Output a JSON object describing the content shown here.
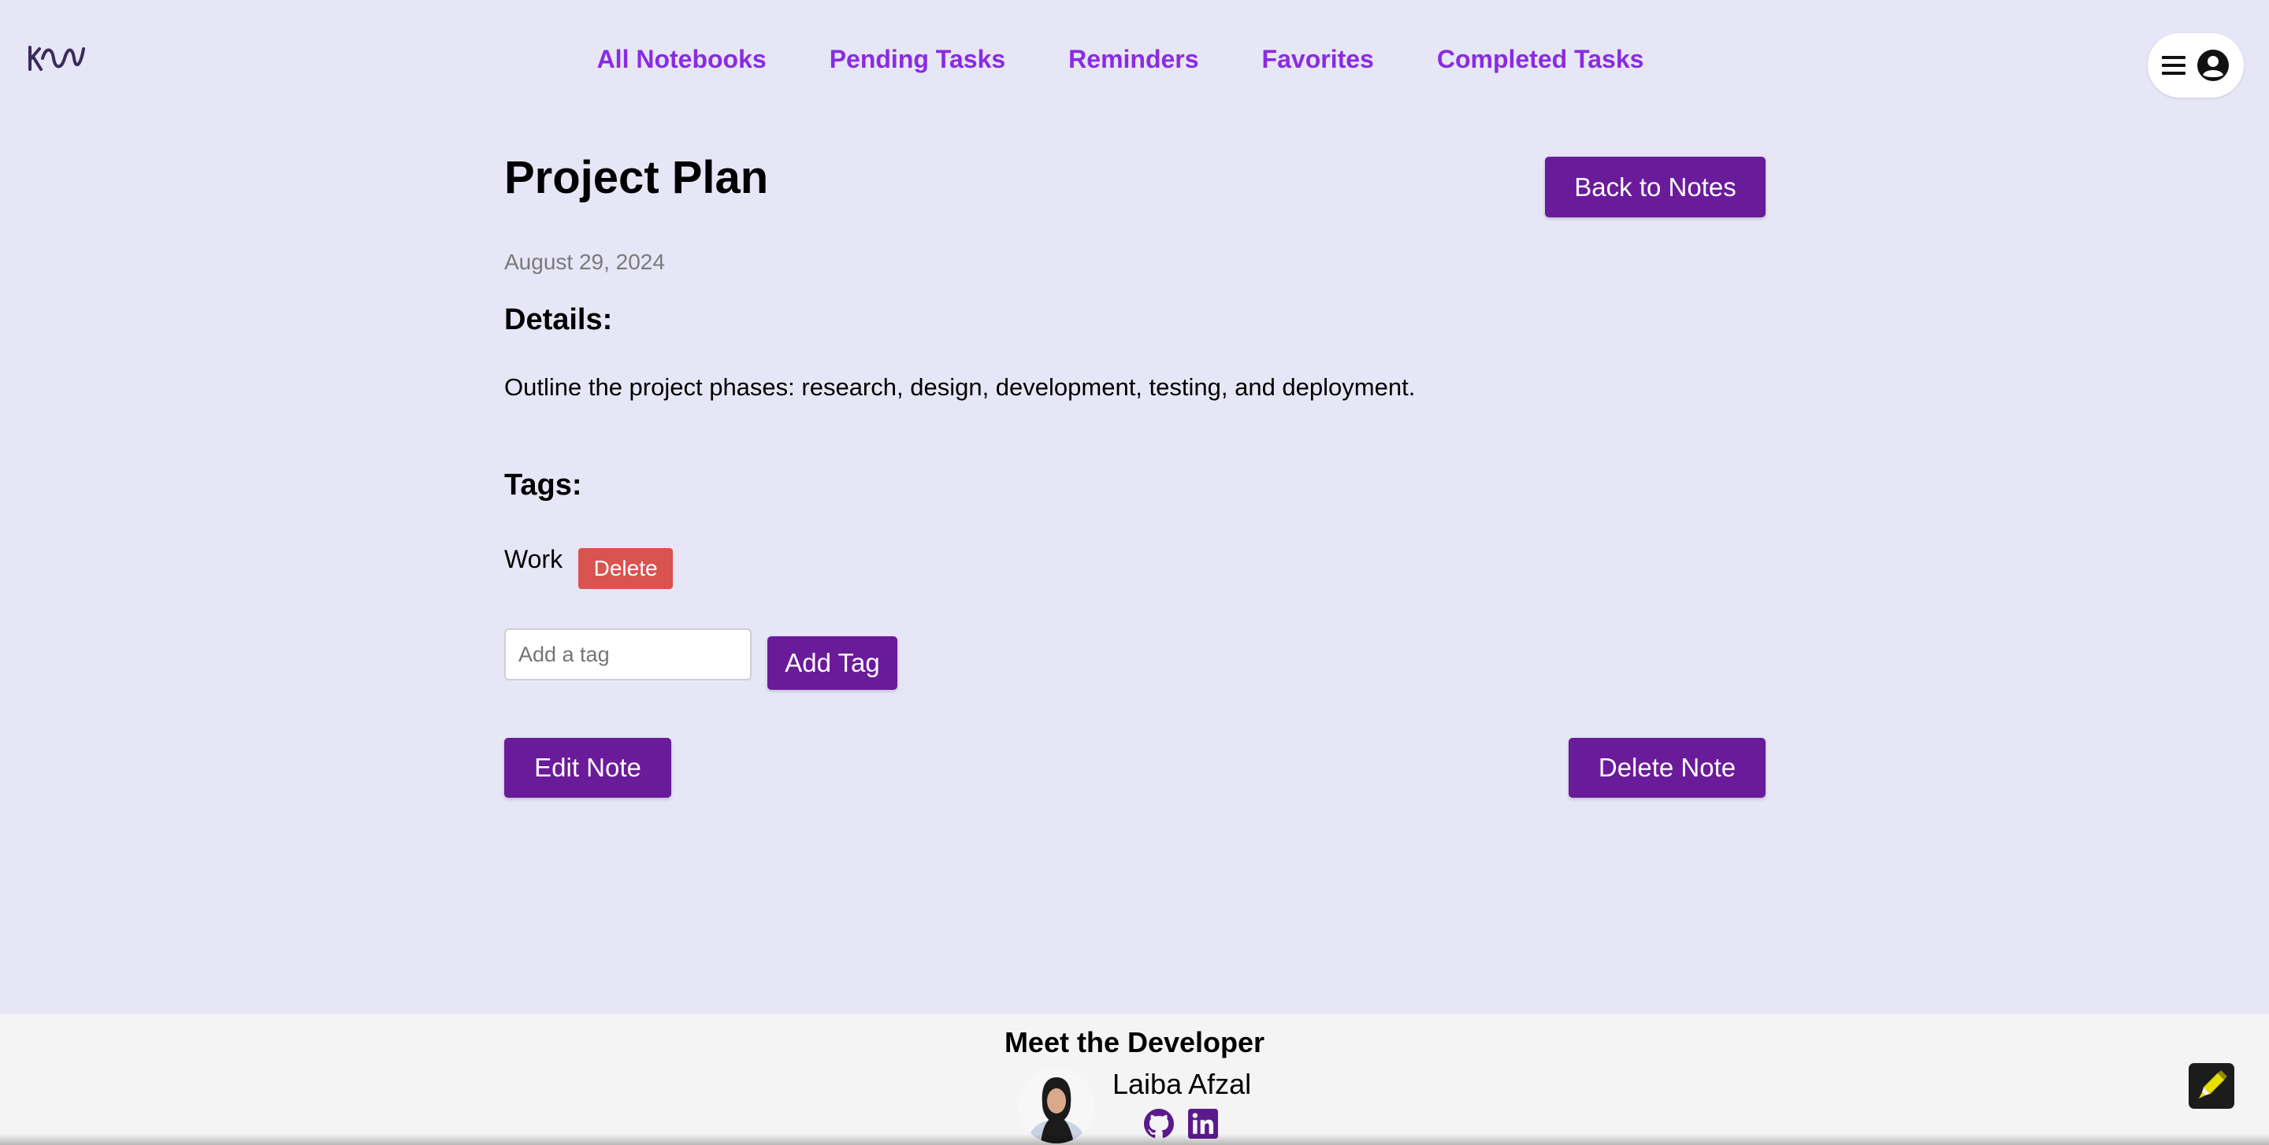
{
  "header": {
    "logo_icon": "kw-wave-logo",
    "nav": [
      {
        "label": "All Notebooks"
      },
      {
        "label": "Pending Tasks"
      },
      {
        "label": "Reminders"
      },
      {
        "label": "Favorites"
      },
      {
        "label": "Completed Tasks"
      }
    ],
    "menu_icons": [
      "hamburger-icon",
      "user-circle-icon"
    ]
  },
  "note": {
    "title": "Project Plan",
    "date": "August 29, 2024",
    "back_label": "Back to Notes",
    "details_heading": "Details:",
    "details_text": "Outline the project phases: research, design, development, testing, and deployment.",
    "tags_heading": "Tags:",
    "tags": [
      {
        "name": "Work",
        "delete_label": "Delete"
      }
    ],
    "tag_input_value": "",
    "tag_input_placeholder": "Add a tag",
    "add_tag_label": "Add Tag",
    "edit_label": "Edit Note",
    "delete_note_label": "Delete Note"
  },
  "footer": {
    "title": "Meet the Developer",
    "developer_name": "Laiba Afzal",
    "social_icons": [
      "github-icon",
      "linkedin-icon"
    ]
  },
  "colors": {
    "page_background": "#e6e6f7",
    "nav_link": "#8a2be2",
    "primary_button": "#6a1b9a",
    "danger_button": "#d9534f",
    "footer_background": "#f4f4f4"
  }
}
